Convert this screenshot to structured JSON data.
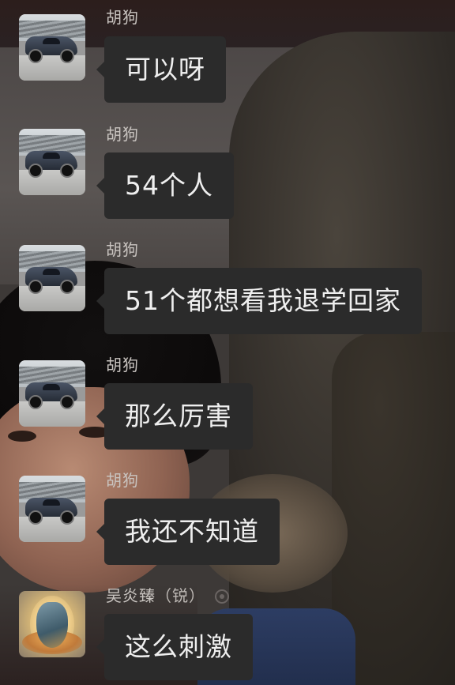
{
  "messages": [
    {
      "sender": "胡狗",
      "sender_extra": "",
      "avatar": "race-car-avatar",
      "text": "可以呀"
    },
    {
      "sender": "胡狗",
      "sender_extra": "",
      "avatar": "race-car-avatar",
      "text": "54个人"
    },
    {
      "sender": "胡狗",
      "sender_extra": "",
      "avatar": "race-car-avatar",
      "text": "51个都想看我退学回家"
    },
    {
      "sender": "胡狗",
      "sender_extra": "",
      "avatar": "race-car-avatar",
      "text": "那么厉害"
    },
    {
      "sender": "胡狗",
      "sender_extra": "",
      "avatar": "race-car-avatar",
      "text": "我还不知道"
    },
    {
      "sender": "吴炎臻",
      "sender_extra": "（锐）",
      "avatar": "dragon-avatar",
      "text": "这么刺激"
    }
  ],
  "colors": {
    "bubble": "#2b2b2b",
    "bubble_text": "#efefef",
    "sender_name": "#c9c4c0"
  }
}
